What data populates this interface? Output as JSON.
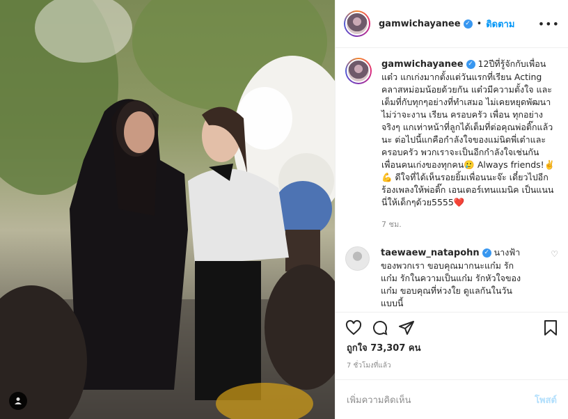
{
  "header": {
    "username": "gamwichayanee",
    "separator": "•",
    "follow_label": "ติดตาม",
    "more_icon": "more-options-icon"
  },
  "caption": {
    "username": "gamwichayanee",
    "text": "12ปีที่รู้จักกับเพื่อนแต๋ว แกเก่งมากตั้งแต่วันแรกที่เรียน Acting คลาสหม่อมน้อยด้วยกัน แต๋วมีความตั้งใจ และเต็มที่กับทุกๆอย่างที่ทำเสมอ ไม่เคยหยุดพัฒนา ไม่ว่าจะงาน เรียน ครอบครัว เพื่อน ทุกอย่างจริงๆ แกเท่าหน้าที่ลูกได้เต็มที่ต่อคุณพ่อติ๊กแล้วนะ ต่อไปนี้แกคือกำลังใจของแม่นิดพี่เต๋าและครอบครัว พวกเราจะเป็นอีกกำลังใจเช่นกัน เพื่อนคนเก่งของทุกคน🥲 Always friends!✌️💪 ดีใจที่ได้เห็นรอยยิ้มเพื่อนนะจ๊ะ เดี๋ยวไปอีก ร้องเพลงให้พ่อติ๊ก เอนเตอร์เทนแมนิค เป็นแนนนี่ให้เด็กๆด้วย5555❤️",
    "time": "7 ชม."
  },
  "comment": {
    "username": "taewaew_natapohn",
    "text": "นางฟ้าของพวกเรา ขอบคุณมากนะแก๋ม รักแก๋ม รักในความเป็นแก๋ม รักหัวใจของแก๋ม ขอบคุณที่ห่วงใย ดูแลกันในวันแบบนี้"
  },
  "engagement": {
    "likes": "ถูกใจ 73,307 คน",
    "posted_ago": "7 ชั่วโมงที่แล้ว"
  },
  "add_comment": {
    "placeholder": "เพิ่มความคิดเห็น",
    "post_label": "โพสต์"
  },
  "colors": {
    "accent": "#0095f6",
    "verified": "#3897f0",
    "heart_red": "#ed4956",
    "post_disabled": "#b2dffc"
  }
}
